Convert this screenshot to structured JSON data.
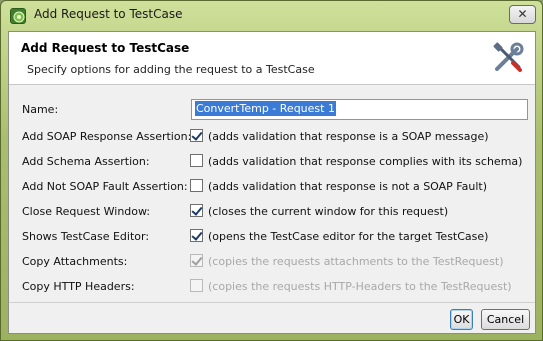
{
  "window": {
    "title": "Add Request to TestCase",
    "close_glyph": "✕"
  },
  "header": {
    "title": "Add Request to TestCase",
    "description": "Specify options for adding the request to a TestCase",
    "icon": "tools-icon"
  },
  "form": {
    "name_label": "Name:",
    "name_value": "ConvertTemp - Request 1",
    "options": [
      {
        "label": "Add SOAP Response Assertion:",
        "checked": true,
        "enabled": true,
        "description": "(adds validation that response is a SOAP message)"
      },
      {
        "label": "Add Schema Assertion:",
        "checked": false,
        "enabled": true,
        "description": "(adds validation that response complies with its schema)"
      },
      {
        "label": "Add Not SOAP Fault Assertion:",
        "checked": false,
        "enabled": true,
        "description": "(adds validation that response is not a SOAP Fault)"
      },
      {
        "label": "Close Request Window:",
        "checked": true,
        "enabled": true,
        "description": "(closes the current window for this request)"
      },
      {
        "label": "Shows TestCase Editor:",
        "checked": true,
        "enabled": true,
        "description": "(opens the TestCase editor for the target TestCase)"
      },
      {
        "label": "Copy Attachments:",
        "checked": true,
        "enabled": false,
        "description": "(copies the requests attachments to the TestRequest)"
      },
      {
        "label": "Copy HTTP Headers:",
        "checked": false,
        "enabled": false,
        "description": "(copies the requests HTTP-Headers to the TestRequest)"
      }
    ]
  },
  "buttons": {
    "ok": "OK",
    "cancel": "Cancel"
  },
  "colors": {
    "titlebar": "#aabf6e",
    "selection": "#3b7bd6",
    "dialog_bg": "#f0f0f0"
  }
}
